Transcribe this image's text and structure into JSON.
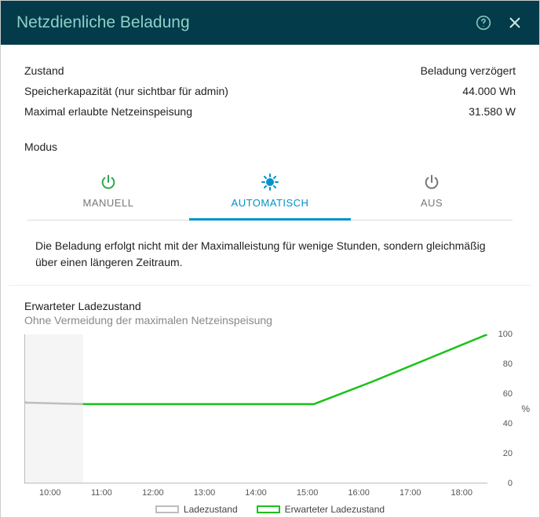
{
  "header": {
    "title": "Netzdienliche Beladung"
  },
  "stats": {
    "zustand_label": "Zustand",
    "zustand_value": "Beladung verzögert",
    "speicher_label": "Speicherkapazität (nur sichtbar für admin)",
    "speicher_value": "44.000 Wh",
    "max_label": "Maximal erlaubte Netzeinspeisung",
    "max_value": "31.580 W"
  },
  "modus": {
    "label": "Modus",
    "tabs": {
      "manuell": "MANUELL",
      "automatisch": "AUTOMATISCH",
      "aus": "AUS"
    },
    "description": "Die Beladung erfolgt nicht mit der Maximalleistung für wenige Stunden, sondern gleichmäßig über einen längeren Zeitraum."
  },
  "chart": {
    "title": "Erwarteter Ladezustand",
    "subtitle": "Ohne Vermeidung der maximalen Netzeinspeisung",
    "yunit": "%",
    "legend": {
      "ladezustand": "Ladezustand",
      "erwartet": "Erwarteter Ladezustand"
    }
  },
  "chart_data": {
    "type": "line",
    "xlabel": "",
    "ylabel": "%",
    "ylim": [
      0,
      100
    ],
    "x_categories": [
      "10:00",
      "11:00",
      "12:00",
      "13:00",
      "14:00",
      "15:00",
      "16:00",
      "17:00",
      "18:00"
    ],
    "y_ticks": [
      0,
      20,
      40,
      60,
      80,
      100
    ],
    "series": [
      {
        "name": "Ladezustand",
        "color": "#bdbdbd",
        "x": [
          "10:00",
          "10:30",
          "11:00"
        ],
        "values": [
          55,
          54,
          53
        ]
      },
      {
        "name": "Erwarteter Ladezustand",
        "color": "#19c219",
        "x": [
          "11:00",
          "12:00",
          "13:00",
          "14:00",
          "15:00",
          "16:00",
          "17:00",
          "18:00"
        ],
        "values": [
          53,
          53,
          53,
          53,
          53,
          68,
          84,
          100
        ]
      }
    ],
    "history_band_end": "11:00"
  }
}
